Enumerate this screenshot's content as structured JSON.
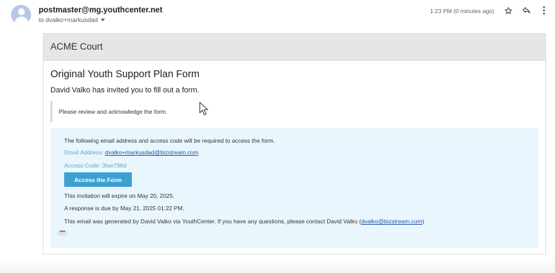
{
  "email": {
    "sender": "postmaster@mg.youthcenter.net",
    "recipient": "to dvalko+markusdad",
    "time": "1:23 PM (0 minutes ago)"
  },
  "icons": {
    "avatar": "person-avatar",
    "star": "star-icon",
    "reply": "reply-icon",
    "more": "more-vertical-icon",
    "caret": "chevron-down-icon"
  },
  "card": {
    "org_name": "ACME Court",
    "form_title": "Original Youth Support Plan Form",
    "invite_text": "David Valko has invited you to fill out a form.",
    "quote_text": "Please review and acknowledge the form.",
    "access": {
      "intro": "The following email address and access code will be required to access the form.",
      "email_label": "Email Address: ",
      "email_value": "dvalko+markusdad@bizstream.com",
      "code_label": "Access Code: 3fae796d",
      "button_label": "Access the Form",
      "expire": "This invitation will expire on May 20, 2025.",
      "due": "A response is due by May 21, 2025 01:22 PM.",
      "generated_prefix": "This email was generated by David Valko via YouthCenter. If you have any questions, please contact David Valko (",
      "generated_email": "dvalko@bizstream.com",
      "generated_suffix": ")",
      "ellipsis": "•••"
    }
  },
  "colors": {
    "header_bar": "#e6e6e6",
    "access_bg": "#eaf6fd",
    "button_bg": "#3da0d2",
    "link": "#1e5aa8",
    "label_blue": "#6ba3c9"
  }
}
